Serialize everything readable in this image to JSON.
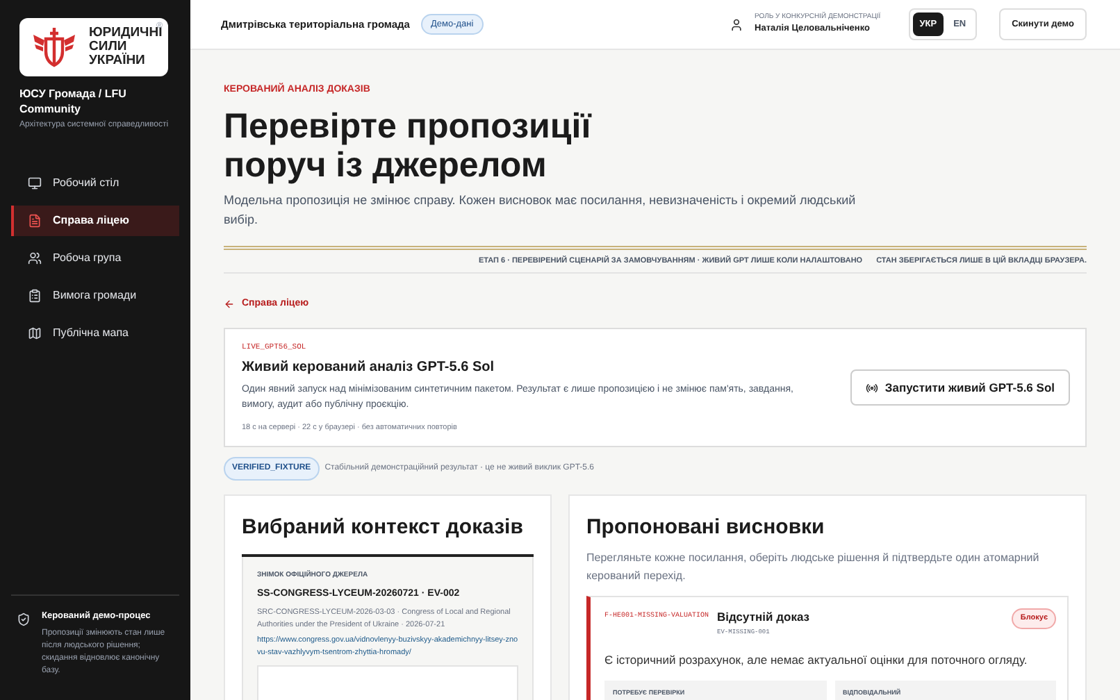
{
  "sidebar": {
    "logo": {
      "lines": [
        "ЮРИДИЧНІ",
        "СИЛИ",
        "УКРАЇНИ"
      ],
      "mark": "®"
    },
    "org_name": "ЮСУ Громада / LFU Community",
    "org_tagline": "Архітектура системної справедливості",
    "items": [
      {
        "label": "Робочий стіл",
        "kind": "desk",
        "selected": false
      },
      {
        "label": "Справа ліцею",
        "kind": "case",
        "selected": true
      },
      {
        "label": "Робоча група",
        "kind": "group",
        "selected": false
      },
      {
        "label": "Вимога громади",
        "kind": "demand",
        "selected": false
      },
      {
        "label": "Публічна мапа",
        "kind": "map",
        "selected": false
      }
    ],
    "footer": {
      "title": "Керований демо-процес",
      "text": "Пропозиції змінюють стан лише після людського рішення; скидання відновлює канонічну базу."
    }
  },
  "header": {
    "community": "Дмитрівська територіальна громада",
    "badge": "Демо-дані",
    "role_label": "РОЛЬ У КОНКУРСНІЙ ДЕМОНСТРАЦІЇ",
    "role_name": "Наталія Целовальніченко",
    "languages": [
      {
        "label": "УКР",
        "selected": true
      },
      {
        "label": "EN",
        "selected": false
      }
    ],
    "reset_button": "Скинути демо"
  },
  "page": {
    "eyebrow": "КЕРОВАНИЙ АНАЛІЗ ДОКАЗІВ",
    "title": "Перевірте пропозиції поруч із джерелом",
    "subtitle": "Модельна пропозиція не змінює справу. Кожен висновок має посилання, невизначеність і окремий людський вибір.",
    "stage": "ЕТАП 6 · ПЕРЕВІРЕНИЙ СЦЕНАРІЙ ЗА ЗАМОВЧУВАННЯМ · ЖИВИЙ GPT ЛИШЕ КОЛИ НАЛАШТОВАНО",
    "storage": "СТАН ЗБЕРІГАЄТЬСЯ ЛИШЕ В ЦІЙ ВКЛАДЦІ БРАУЗЕРА.",
    "back_link": "Справа ліцею"
  },
  "live_card": {
    "code": "LIVE_GPT56_SOL",
    "title": "Живий керований аналіз GPT-5.6 Sol",
    "description": "Один явний запуск над мінімізованим синтетичним пакетом. Результат є лише пропозицією і не змінює пам'ять, завдання, вимогу, аудит або публічну проєкцію.",
    "meta": "18 с на сервері · 22 с у браузері · без автоматичних повторів",
    "button": "Запустити живий GPT-5.6 Sol"
  },
  "fixture": {
    "badge": "VERIFIED_FIXTURE",
    "text": "Стабільний демонстраційний результат · це не живий виклик GPT-5.6"
  },
  "context": {
    "title": "Вибраний контекст доказів",
    "source_label": "ЗНІМОК ОФІЦІЙНОГО ДЖЕРЕЛА",
    "source_id": "SS-CONGRESS-LYCEUM-20260721 · EV-002",
    "source_meta": "SRC-CONGRESS-LYCEUM-2026-03-03 · Congress of Local and Regional Authorities under the President of Ukraine · 2026-07-21",
    "url": "https://www.congress.gov.ua/vidnovlenyy-buzivskyy-akademichnyy-litsey-znovu-stav-vazhlyvym-tsentrom-zhyttia-hromady/"
  },
  "findings": {
    "title": "Пропоновані висновки",
    "intro": "Перегляньте кожне посилання, оберіть людське рішення й підтвердьте один атомарний керований перехід.",
    "items": [
      {
        "code": "F-HE001-MISSING-VALUATION",
        "title": "Відсутній доказ",
        "evidence": "EV-MISSING-001",
        "status": "Блокує",
        "kind": "blocking",
        "summary": "Є історичний розрахунок, але немає актуальної оцінки для поточного огляду.",
        "fields": [
          "ПОТРЕБУЄ ПЕРЕВІРКИ",
          "ВІДПОВІДАЛЬНИЙ"
        ]
      }
    ]
  }
}
